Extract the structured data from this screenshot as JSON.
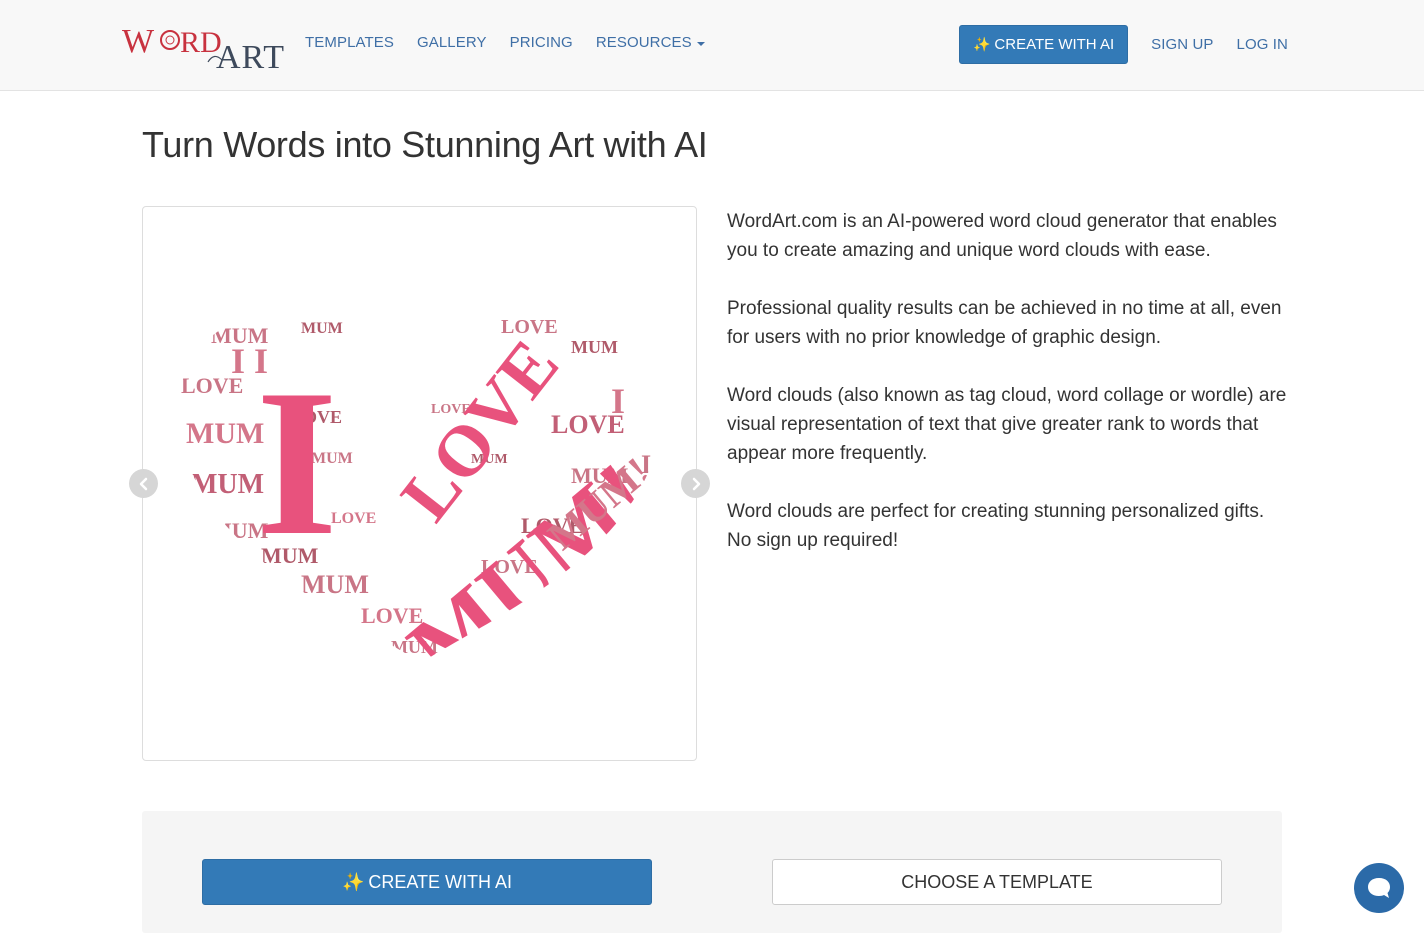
{
  "header": {
    "logo_text": "WORDART",
    "nav": [
      {
        "label": "TEMPLATES"
      },
      {
        "label": "GALLERY"
      },
      {
        "label": "PRICING"
      },
      {
        "label": "RESOURCES"
      }
    ],
    "create_ai_label": "CREATE WITH AI",
    "signup_label": "SIGN UP",
    "login_label": "LOG IN"
  },
  "main": {
    "title": "Turn Words into Stunning Art with AI",
    "paragraphs": [
      "WordArt.com is an AI-powered word cloud generator that enables you to create amazing and unique word clouds with ease.",
      "Professional quality results can be achieved in no time at all, even for users with no prior knowledge of graphic design.",
      "Word clouds (also known as tag cloud, word collage or wordle) are visual representation of text that give greater rank to words that appear more frequently.",
      "Word clouds are perfect for creating stunning personalized gifts. No sign up required!"
    ]
  },
  "carousel": {
    "words": [
      "I",
      "LOVE",
      "MUM!"
    ],
    "colors": {
      "primary": "#e8527d",
      "secondary": "#c97586",
      "tertiary": "#b05a6a"
    }
  },
  "cta": {
    "create_ai_label": "CREATE WITH AI",
    "template_label": "CHOOSE A TEMPLATE"
  },
  "colors": {
    "accent": "#337ab7",
    "nav_link": "#3f6fa6",
    "chat": "#2b6aa8"
  }
}
